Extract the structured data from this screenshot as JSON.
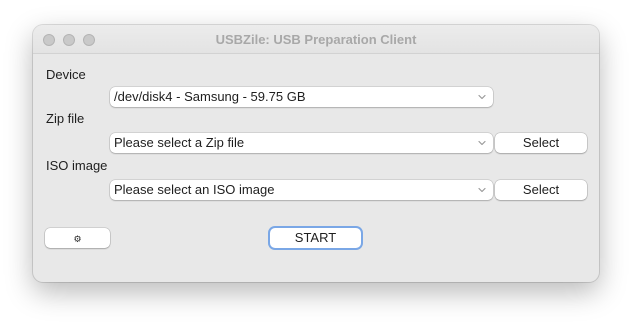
{
  "window": {
    "title": "USBZile: USB Preparation Client"
  },
  "device": {
    "label": "Device",
    "selected": "/dev/disk4 - Samsung - 59.75 GB"
  },
  "zip": {
    "label": "Zip file",
    "selected": "Please select a Zip file",
    "button_label": "Select"
  },
  "iso": {
    "label": "ISO image",
    "selected": "Please select an ISO image",
    "button_label": "Select"
  },
  "actions": {
    "settings_icon": "gear-icon",
    "settings_glyph": "⚙",
    "start_label": "START"
  },
  "colors": {
    "focus_ring": "#7aa7e6",
    "window_bg": "#e8e8e8"
  }
}
